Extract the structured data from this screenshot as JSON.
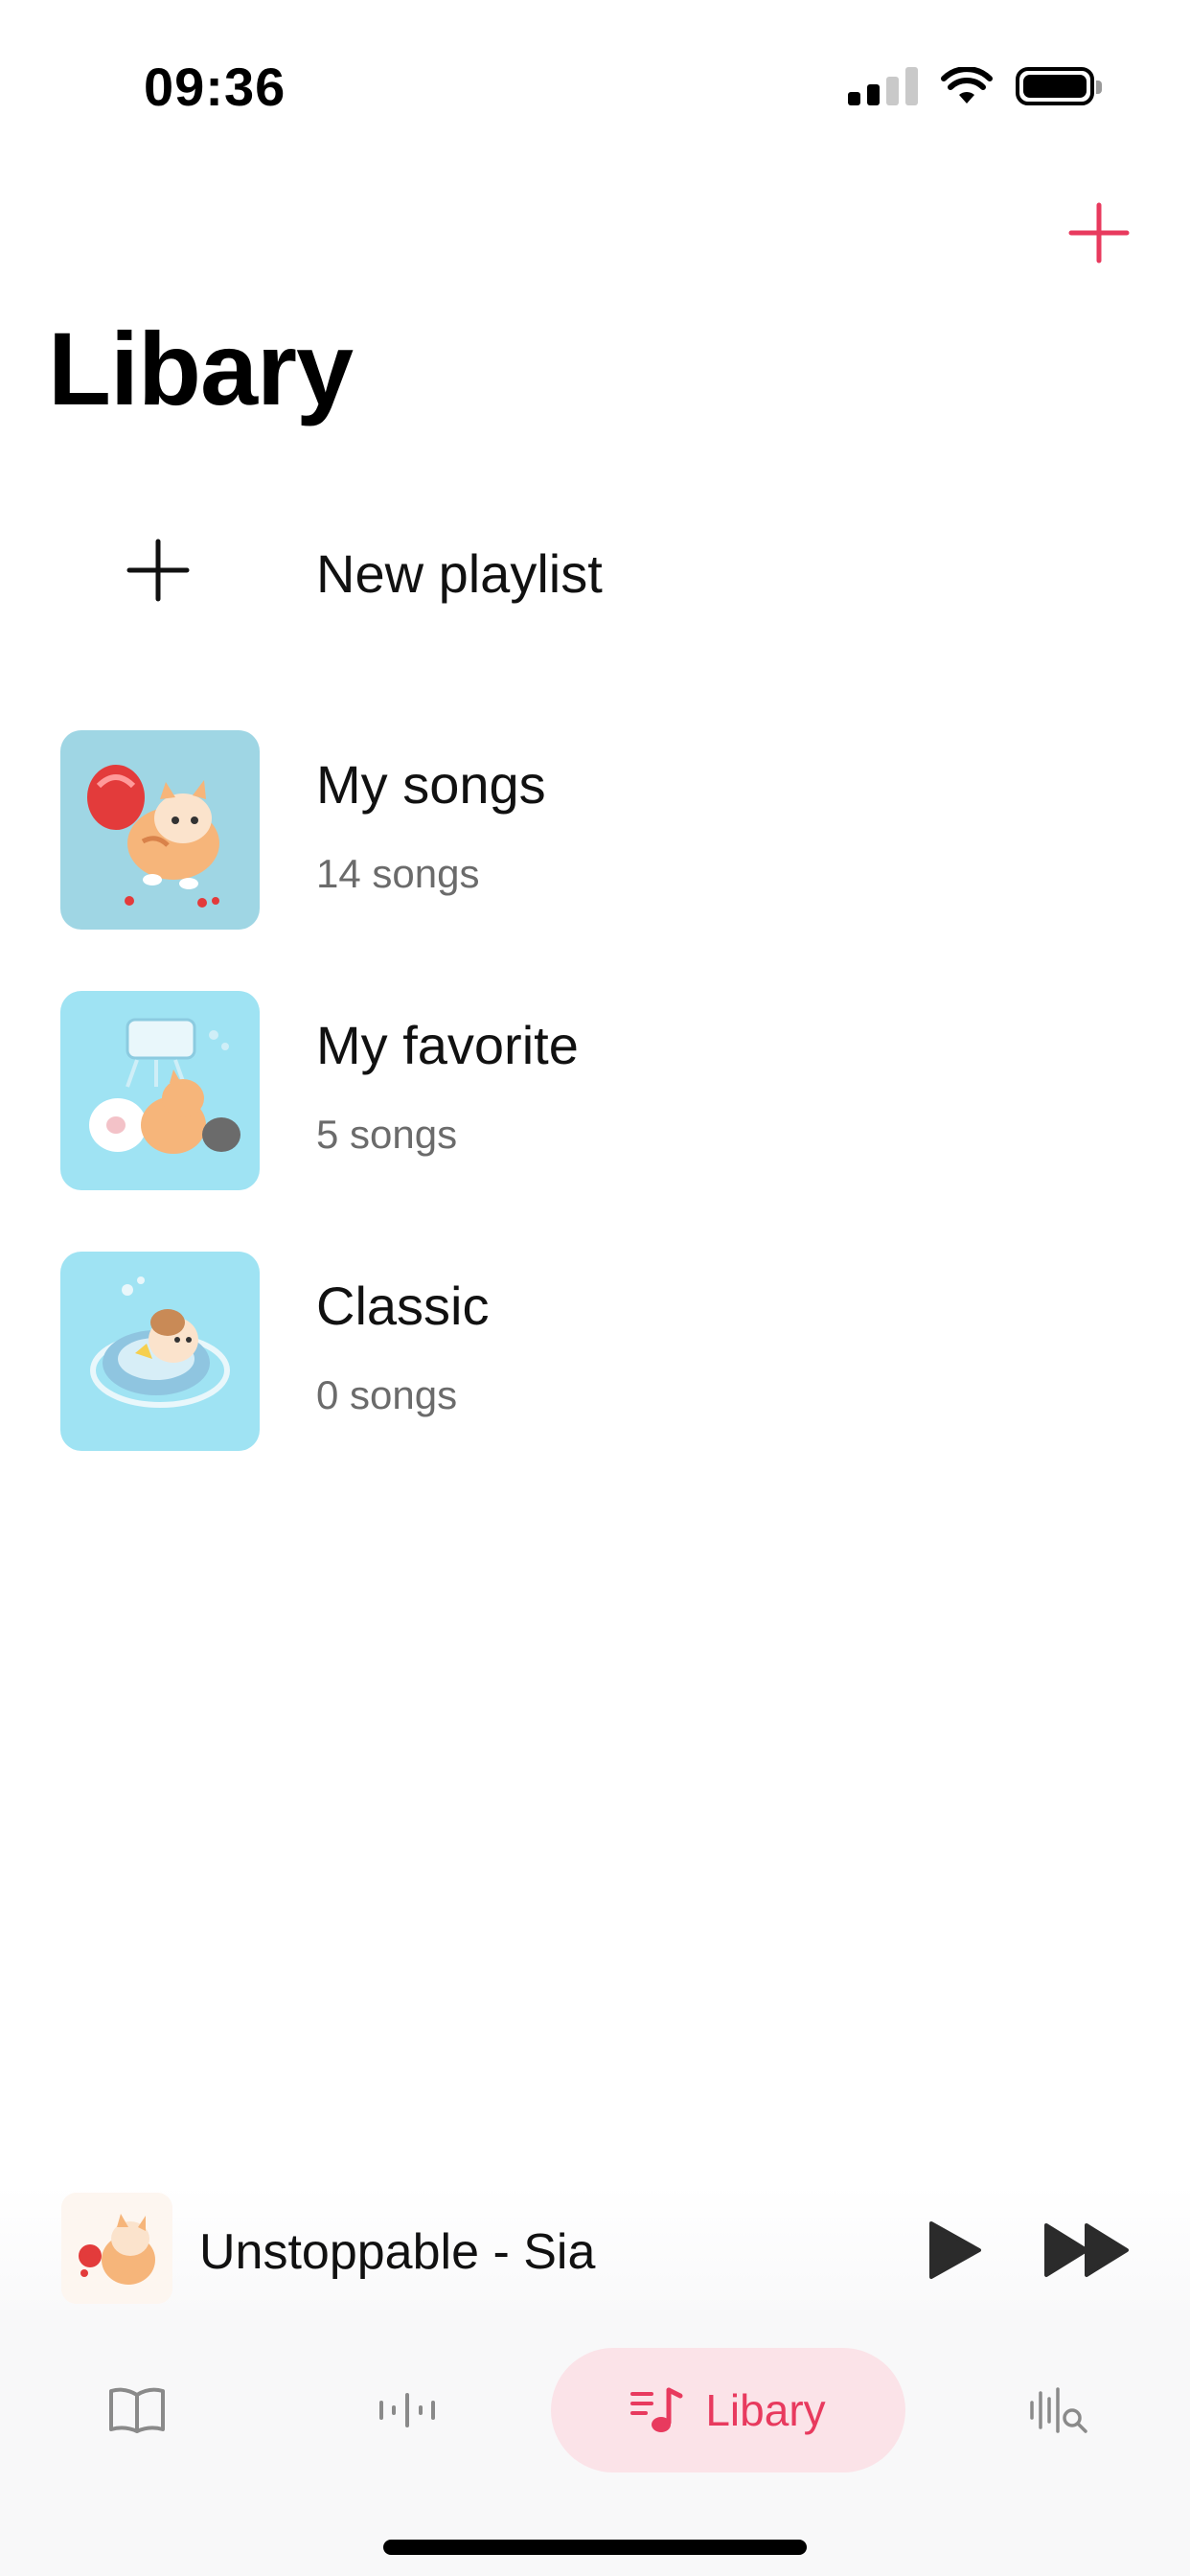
{
  "status_bar": {
    "time": "09:36"
  },
  "header": {
    "title": "Libary",
    "add_icon": "plus-icon"
  },
  "new_playlist": {
    "label": "New playlist",
    "icon": "plus-icon"
  },
  "playlists": [
    {
      "name": "My songs",
      "count": "14 songs",
      "art": "cat-with-heart-art"
    },
    {
      "name": "My favorite",
      "count": "5 songs",
      "art": "cats-playing-art"
    },
    {
      "name": "Classic",
      "count": "0 songs",
      "art": "cat-on-float-art"
    }
  ],
  "now_playing": {
    "title": "Unstoppable - Sia",
    "play_icon": "play-icon",
    "next_icon": "fast-forward-icon"
  },
  "tabs": [
    {
      "key": "read",
      "icon": "book-icon"
    },
    {
      "key": "listen",
      "icon": "waveform-icon"
    },
    {
      "key": "library",
      "label": "Libary",
      "icon": "music-list-icon",
      "active": true
    },
    {
      "key": "search",
      "icon": "audio-search-icon"
    }
  ],
  "colors": {
    "accent": "#e83a5e",
    "accent_bg": "#fbe3e8",
    "art_bg": "#9fe3f3"
  }
}
